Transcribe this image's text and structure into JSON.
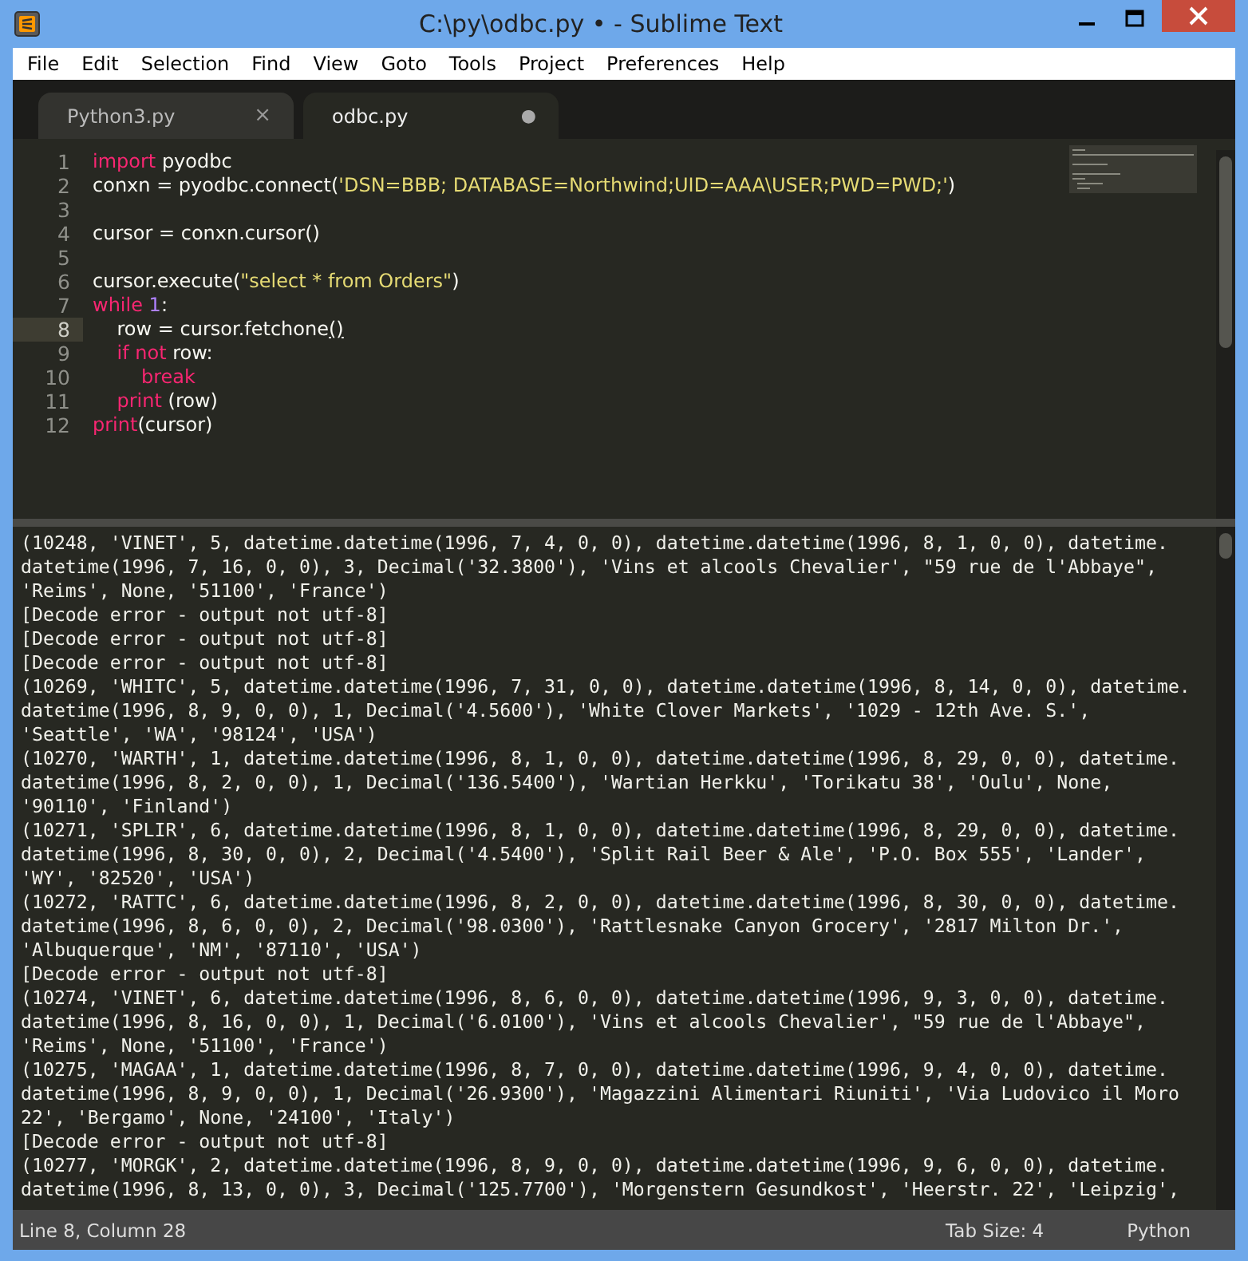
{
  "window": {
    "title": "C:\\py\\odbc.py • - Sublime Text"
  },
  "menu": [
    "File",
    "Edit",
    "Selection",
    "Find",
    "View",
    "Goto",
    "Tools",
    "Project",
    "Preferences",
    "Help"
  ],
  "tabs": [
    {
      "label": "Python3.py",
      "selected": false,
      "modified": false,
      "close": "×"
    },
    {
      "label": "odbc.py",
      "selected": true,
      "modified": true,
      "close": "●"
    }
  ],
  "editor": {
    "lines": [
      {
        "number": "1",
        "current": false,
        "tokens": [
          {
            "kind": "keyword",
            "text": "import"
          },
          {
            "kind": "plain",
            "text": " pyodbc"
          }
        ]
      },
      {
        "number": "2",
        "current": false,
        "tokens": [
          {
            "kind": "plain",
            "text": "conxn = pyodbc.connect("
          },
          {
            "kind": "string",
            "text": "'DSN=BBB; DATABASE=Northwind;UID=AAA\\USER;PWD=PWD;'"
          },
          {
            "kind": "plain",
            "text": ")"
          }
        ]
      },
      {
        "number": "3",
        "current": false
      },
      {
        "number": "4",
        "current": false,
        "tokens": [
          {
            "kind": "plain",
            "text": "cursor = conxn.cursor()"
          }
        ]
      },
      {
        "number": "5",
        "current": false
      },
      {
        "number": "6",
        "current": false,
        "tokens": [
          {
            "kind": "plain",
            "text": "cursor.execute("
          },
          {
            "kind": "string",
            "text": "\"select * from Orders\""
          },
          {
            "kind": "plain",
            "text": ")"
          }
        ]
      },
      {
        "number": "7",
        "current": false,
        "tokens": [
          {
            "kind": "keyword",
            "text": "while"
          },
          {
            "kind": "number",
            "text": " 1"
          },
          {
            "kind": "plain",
            "text": ":"
          }
        ]
      },
      {
        "number": "8",
        "current": true,
        "tokens": [
          {
            "kind": "plain",
            "text": "    row = cursor.fetchone"
          },
          {
            "kind": "matched",
            "text": "()"
          }
        ]
      },
      {
        "number": "9",
        "current": false,
        "tokens": [
          {
            "kind": "keyword",
            "text": "    if not"
          },
          {
            "kind": "plain",
            "text": " row:"
          }
        ]
      },
      {
        "number": "10",
        "current": false,
        "tokens": [
          {
            "kind": "keyword",
            "text": "        break"
          }
        ]
      },
      {
        "number": "11",
        "current": false,
        "tokens": [
          {
            "kind": "keyword",
            "text": "    print"
          },
          {
            "kind": "plain",
            "text": " (row)"
          }
        ]
      },
      {
        "number": "12",
        "current": false,
        "tokens": [
          {
            "kind": "keyword",
            "text": "print"
          },
          {
            "kind": "plain",
            "text": "(cursor)"
          }
        ]
      }
    ]
  },
  "console": {
    "lines": [
      "(10248, 'VINET', 5, datetime.datetime(1996, 7, 4, 0, 0), datetime.datetime(1996, 8, 1, 0, 0), datetime.",
      "datetime(1996, 7, 16, 0, 0), 3, Decimal('32.3800'), 'Vins et alcools Chevalier', \"59 rue de l'Abbaye\",",
      "'Reims', None, '51100', 'France')",
      "[Decode error - output not utf-8]",
      "[Decode error - output not utf-8]",
      "[Decode error - output not utf-8]",
      "(10269, 'WHITC', 5, datetime.datetime(1996, 7, 31, 0, 0), datetime.datetime(1996, 8, 14, 0, 0), datetime.",
      "datetime(1996, 8, 9, 0, 0), 1, Decimal('4.5600'), 'White Clover Markets', '1029 - 12th Ave. S.',",
      "'Seattle', 'WA', '98124', 'USA')",
      "(10270, 'WARTH', 1, datetime.datetime(1996, 8, 1, 0, 0), datetime.datetime(1996, 8, 29, 0, 0), datetime.",
      "datetime(1996, 8, 2, 0, 0), 1, Decimal('136.5400'), 'Wartian Herkku', 'Torikatu 38', 'Oulu', None,",
      "'90110', 'Finland')",
      "(10271, 'SPLIR', 6, datetime.datetime(1996, 8, 1, 0, 0), datetime.datetime(1996, 8, 29, 0, 0), datetime.",
      "datetime(1996, 8, 30, 0, 0), 2, Decimal('4.5400'), 'Split Rail Beer & Ale', 'P.O. Box 555', 'Lander',",
      "'WY', '82520', 'USA')",
      "(10272, 'RATTC', 6, datetime.datetime(1996, 8, 2, 0, 0), datetime.datetime(1996, 8, 30, 0, 0), datetime.",
      "datetime(1996, 8, 6, 0, 0), 2, Decimal('98.0300'), 'Rattlesnake Canyon Grocery', '2817 Milton Dr.',",
      "'Albuquerque', 'NM', '87110', 'USA')",
      "[Decode error - output not utf-8]",
      "(10274, 'VINET', 6, datetime.datetime(1996, 8, 6, 0, 0), datetime.datetime(1996, 9, 3, 0, 0), datetime.",
      "datetime(1996, 8, 16, 0, 0), 1, Decimal('6.0100'), 'Vins et alcools Chevalier', \"59 rue de l'Abbaye\",",
      "'Reims', None, '51100', 'France')",
      "(10275, 'MAGAA', 1, datetime.datetime(1996, 8, 7, 0, 0), datetime.datetime(1996, 9, 4, 0, 0), datetime.",
      "datetime(1996, 8, 9, 0, 0), 1, Decimal('26.9300'), 'Magazzini Alimentari Riuniti', 'Via Ludovico il Moro",
      "22', 'Bergamo', None, '24100', 'Italy')",
      "[Decode error - output not utf-8]",
      "(10277, 'MORGK', 2, datetime.datetime(1996, 8, 9, 0, 0), datetime.datetime(1996, 9, 6, 0, 0), datetime.",
      "datetime(1996, 8, 13, 0, 0), 3, Decimal('125.7700'), 'Morgenstern Gesundkost', 'Heerstr. 22', 'Leipzig',"
    ]
  },
  "status_bar": {
    "position": "Line 8, Column 28",
    "tab_size": "Tab Size: 4",
    "syntax": "Python"
  }
}
